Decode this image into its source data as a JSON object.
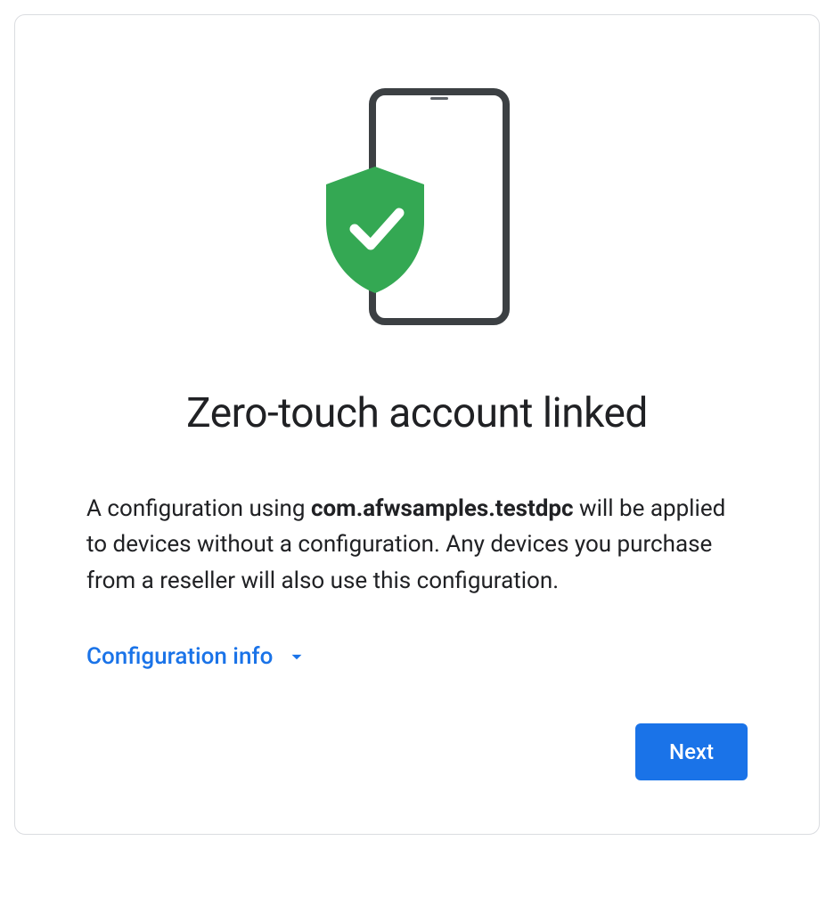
{
  "title": "Zero-touch account linked",
  "description": {
    "prefix": "A configuration using ",
    "package": "com.afwsamples.testdpc",
    "suffix": " will be applied to devices without a configuration. Any devices you purchase from a reseller will also use this configuration."
  },
  "expander": {
    "label": "Configuration info"
  },
  "actions": {
    "next": "Next"
  },
  "colors": {
    "accent": "#1a73e8",
    "shield": "#34a853"
  }
}
